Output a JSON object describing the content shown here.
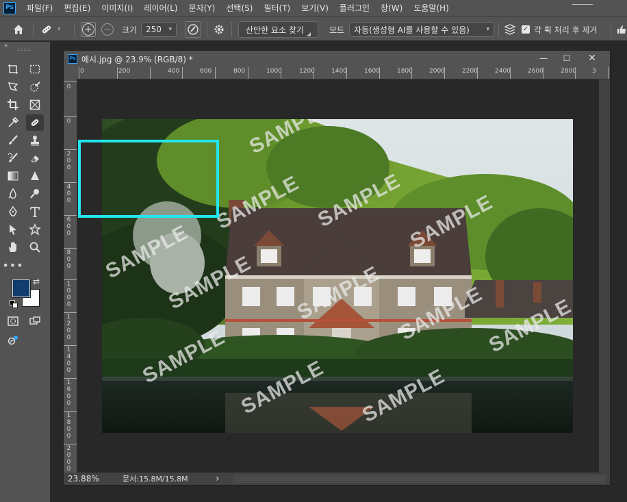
{
  "menu": {
    "logo": "Ps",
    "items": [
      "파일(F)",
      "편집(E)",
      "이미지(I)",
      "레이어(L)",
      "문자(Y)",
      "선택(S)",
      "필터(T)",
      "보기(V)",
      "플러그인",
      "창(W)",
      "도움말(H)"
    ]
  },
  "options": {
    "size_label": "크기",
    "size_value": "250",
    "find_distractions_label": "산만한 요소 찾기",
    "mode_label": "모드",
    "mode_value": "자동(생성형 AI를 사용할 수 있음)",
    "per_stroke_label": "각 획 처리 후 제거",
    "per_stroke_checked": true
  },
  "document": {
    "title": "예시.jpg @ 23.9% (RGB/8) *",
    "zoom": "23.88%",
    "doc_info": "문서:15.8M/15.8M",
    "status_arrow": "›"
  },
  "rulers": {
    "horizontal": [
      "0",
      "200",
      "400",
      "600",
      "800",
      "1000",
      "1200",
      "1400",
      "1600",
      "1800",
      "2000",
      "2200",
      "2400",
      "2600",
      "2800",
      "3"
    ],
    "vertical": [
      "0",
      "0",
      "200",
      "400",
      "600",
      "800",
      "1000",
      "1200",
      "1400",
      "1600",
      "1800",
      "2000"
    ]
  },
  "canvas": {
    "watermark_text": "SAMPLE"
  },
  "colors": {
    "foreground": "#123c6e",
    "background": "#ffffff",
    "selection": "#22e6ee",
    "accent": "#31a8ff"
  }
}
